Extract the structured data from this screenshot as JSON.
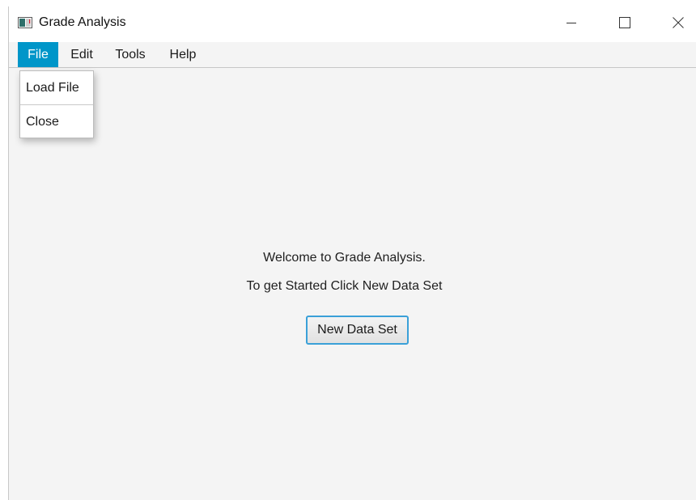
{
  "window": {
    "title": "Grade Analysis",
    "icon": "app-window-icon",
    "controls": {
      "minimize_icon": "minimize-icon",
      "maximize_icon": "maximize-icon",
      "close_icon": "close-icon"
    }
  },
  "menubar": {
    "items": [
      {
        "label": "File",
        "active": true
      },
      {
        "label": "Edit"
      },
      {
        "label": "Tools"
      },
      {
        "label": "Help"
      }
    ],
    "active_color": "#0096c9"
  },
  "file_menu": {
    "items": [
      {
        "label": "Load File"
      },
      {
        "label": "Close"
      }
    ]
  },
  "main": {
    "welcome_line1": "Welcome to Grade Analysis.",
    "welcome_line2": "To get Started Click New Data Set",
    "new_data_button": "New Data Set"
  },
  "colors": {
    "background": "#f4f4f4",
    "button_focus_border": "#3aa0d8"
  }
}
